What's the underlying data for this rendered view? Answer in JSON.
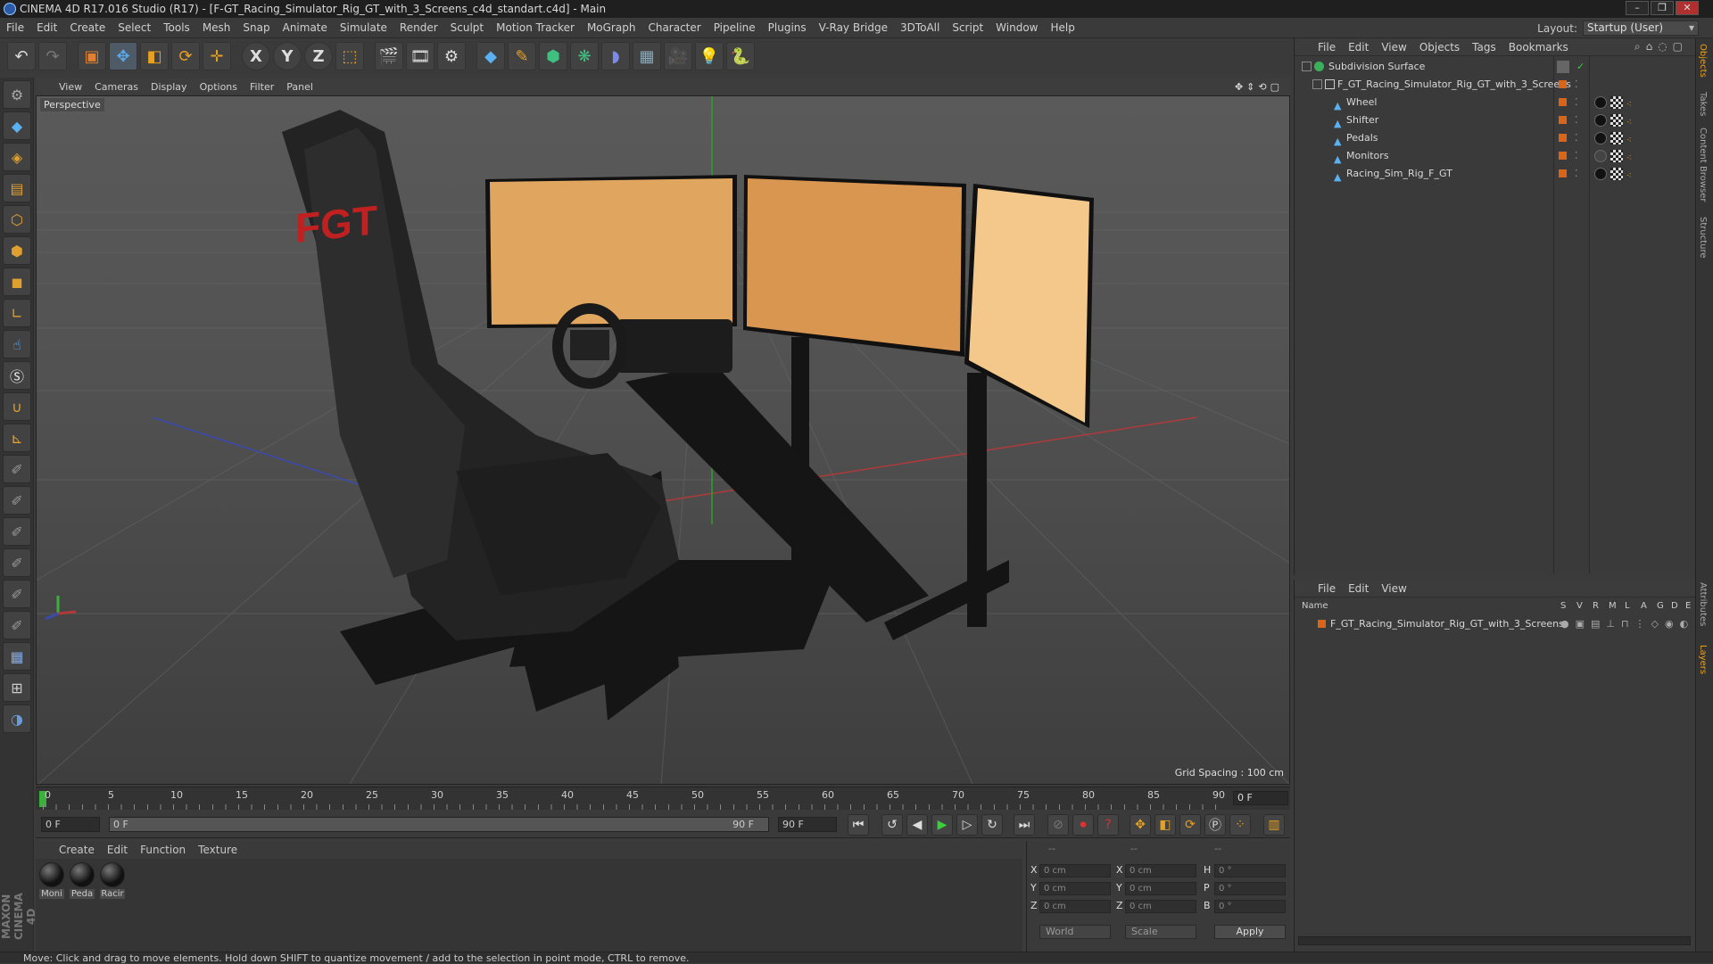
{
  "window": {
    "title": "CINEMA 4D R17.016 Studio (R17) - [F-GT_Racing_Simulator_Rig_GT_with_3_Screens_c4d_standart.c4d] - Main",
    "controls": [
      "–",
      "❐",
      "✕"
    ]
  },
  "menu": [
    "File",
    "Edit",
    "Create",
    "Select",
    "Tools",
    "Mesh",
    "Snap",
    "Animate",
    "Simulate",
    "Render",
    "Sculpt",
    "Motion Tracker",
    "MoGraph",
    "Character",
    "Pipeline",
    "Plugins",
    "V-Ray Bridge",
    "3DToAll",
    "Script",
    "Window",
    "Help"
  ],
  "layout": {
    "label": "Layout:",
    "value": "Startup (User)"
  },
  "toolbar": {
    "icons": [
      "undo-icon",
      "redo-icon",
      "select-icon",
      "move-icon",
      "scale-icon",
      "rotate-icon",
      "transform-icon",
      "x-axis-icon",
      "y-axis-icon",
      "z-axis-icon",
      "coord-system-icon",
      "render-view-icon",
      "render-picture-queue-icon",
      "render-settings-icon",
      "cube-icon",
      "pen-icon",
      "subdivision-icon",
      "cloner-icon",
      "deformer-icon",
      "floor-icon",
      "camera-icon",
      "light-icon",
      "python-icon"
    ],
    "axis_labels": [
      "X",
      "Y",
      "Z"
    ]
  },
  "left_tools": [
    "make-editable-icon",
    "model-mode-icon",
    "texture-mode-icon",
    "workplane-icon",
    "points-mode-icon",
    "edges-mode-icon",
    "polygons-mode-icon",
    "axis-mode-icon",
    "tweak-icon",
    "snap-icon",
    "magnet-icon",
    "l-axis-icon",
    "sculpt-brush-1-icon",
    "sculpt-brush-2-icon",
    "sculpt-brush-3-icon",
    "sculpt-brush-4-icon",
    "sculpt-brush-5-icon",
    "sculpt-brush-6-icon",
    "locked-workplane-icon",
    "grid-icon",
    "python-icon"
  ],
  "viewport": {
    "menu": [
      "View",
      "Cameras",
      "Display",
      "Options",
      "Filter",
      "Panel"
    ],
    "label": "Perspective",
    "grid_spacing": "Grid Spacing : 100 cm",
    "brand_logo": "FGT"
  },
  "timeline": {
    "ticks": [
      "0",
      "5",
      "10",
      "15",
      "20",
      "25",
      "30",
      "35",
      "40",
      "45",
      "50",
      "55",
      "60",
      "65",
      "70",
      "75",
      "80",
      "85",
      "90"
    ],
    "current_frame": "0 F",
    "start_field": "0 F",
    "range_start": "0 F",
    "range_end": "90 F",
    "end_field": "90 F"
  },
  "material": {
    "menu": [
      "Create",
      "Edit",
      "Function",
      "Texture"
    ],
    "items": [
      {
        "label": "Moni"
      },
      {
        "label": "Peda"
      },
      {
        "label": "Racir"
      }
    ]
  },
  "coords": {
    "headers": [
      "--",
      "--",
      "--"
    ],
    "rows": [
      {
        "a": "X",
        "av": "0 cm",
        "b": "X",
        "bv": "0 cm",
        "c": "H",
        "cv": "0 °"
      },
      {
        "a": "Y",
        "av": "0 cm",
        "b": "Y",
        "bv": "0 cm",
        "c": "P",
        "cv": "0 °"
      },
      {
        "a": "Z",
        "av": "0 cm",
        "b": "Z",
        "bv": "0 cm",
        "c": "B",
        "cv": "0 °"
      }
    ],
    "world": "World",
    "scale": "Scale",
    "apply": "Apply"
  },
  "status": "Move: Click and drag to move elements. Hold down SHIFT to quantize movement / add to the selection in point mode, CTRL to remove.",
  "objects": {
    "menu": [
      "File",
      "Edit",
      "View",
      "Objects",
      "Tags",
      "Bookmarks"
    ],
    "items": [
      {
        "name": "Subdivision Surface",
        "level": 0
      },
      {
        "name": "F_GT_Racing_Simulator_Rig_GT_with_3_Screens",
        "level": 1
      },
      {
        "name": "Wheel",
        "level": 2
      },
      {
        "name": "Shifter",
        "level": 2
      },
      {
        "name": "Pedals",
        "level": 2
      },
      {
        "name": "Monitors",
        "level": 2
      },
      {
        "name": "Racing_Sim_Rig_F_GT",
        "level": 2
      }
    ]
  },
  "layers": {
    "menu": [
      "File",
      "Edit",
      "View"
    ],
    "col_name": "Name",
    "cols": [
      "S",
      "V",
      "R",
      "M",
      "L",
      "A",
      "G",
      "D",
      "E"
    ],
    "items": [
      {
        "name": "F_GT_Racing_Simulator_Rig_GT_with_3_Screens"
      }
    ]
  },
  "dock_tabs": [
    "Objects",
    "Takes",
    "Content Browser",
    "Structure",
    "Attributes",
    "Layers"
  ],
  "colors": {
    "accent": "#d8651a",
    "bg": "#3b3b3b",
    "sphere_icon": "#3b8fd8"
  }
}
